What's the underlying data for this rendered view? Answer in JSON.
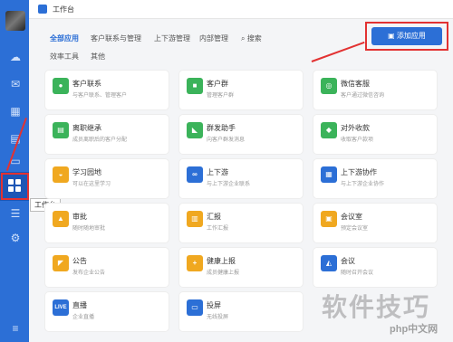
{
  "header": {
    "title": "工作台"
  },
  "tabs": [
    "全部应用",
    "客户联系与管理",
    "上下游管理",
    "内部管理",
    "搜索",
    "效率工具",
    "其他"
  ],
  "add_button": "添加应用",
  "tooltip": "工作台",
  "apps": [
    {
      "title": "客户联系",
      "desc": "与客户联系、管理客户",
      "color": "#3bb35a",
      "icon": "●"
    },
    {
      "title": "客户群",
      "desc": "管理客户群",
      "color": "#3bb35a",
      "icon": "■"
    },
    {
      "title": "微信客服",
      "desc": "客户通过微信咨询",
      "color": "#3bb35a",
      "icon": "◎"
    },
    {
      "title": "离职继承",
      "desc": "成员离职后的客户分配",
      "color": "#3bb35a",
      "icon": "▤"
    },
    {
      "title": "群发助手",
      "desc": "向客户群发消息",
      "color": "#3bb35a",
      "icon": "◣"
    },
    {
      "title": "对外收款",
      "desc": "收取客户款项",
      "color": "#3bb35a",
      "icon": "◆"
    },
    {
      "title": "学习园地",
      "desc": "可以在这里学习",
      "color": "#f0a820",
      "icon": "◒"
    },
    {
      "title": "上下游",
      "desc": "与上下游企业联系",
      "color": "#2c6fd6",
      "icon": "∞"
    },
    {
      "title": "上下游协作",
      "desc": "与上下游企业协作",
      "color": "#2c6fd6",
      "icon": "▦"
    },
    {
      "title": "审批",
      "desc": "随时随地审批",
      "color": "#f0a820",
      "icon": "▲"
    },
    {
      "title": "汇报",
      "desc": "工作汇报",
      "color": "#f0a820",
      "icon": "▥"
    },
    {
      "title": "会议室",
      "desc": "预定会议室",
      "color": "#f0a820",
      "icon": "▣"
    },
    {
      "title": "公告",
      "desc": "发布企业公告",
      "color": "#f0a820",
      "icon": "◤"
    },
    {
      "title": "健康上报",
      "desc": "成员健康上报",
      "color": "#f0a820",
      "icon": "+"
    },
    {
      "title": "会议",
      "desc": "随时召开会议",
      "color": "#2c6fd6",
      "icon": "◭"
    },
    {
      "title": "直播",
      "desc": "企业直播",
      "color": "#2c6fd6",
      "icon": "LIVE"
    },
    {
      "title": "投屏",
      "desc": "无线投屏",
      "color": "#2c6fd6",
      "icon": "▭"
    }
  ],
  "watermark": "软件技巧",
  "watermark_small": "php中文网"
}
